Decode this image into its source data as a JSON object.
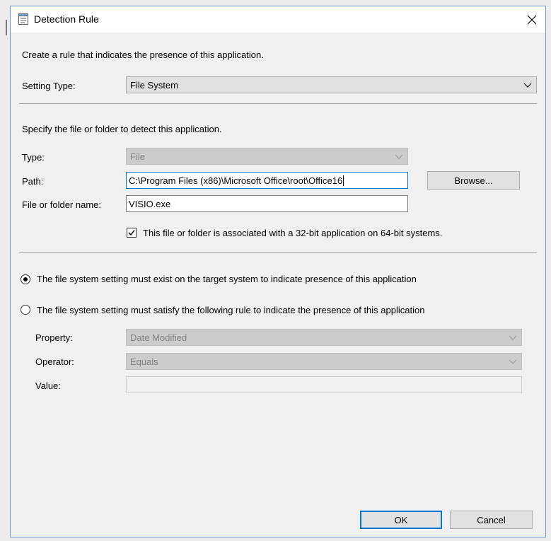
{
  "window": {
    "title": "Detection Rule"
  },
  "intro": "Create a rule that indicates the presence of this application.",
  "setting_type": {
    "label": "Setting Type:",
    "value": "File System"
  },
  "file_section": {
    "heading": "Specify the file or folder to detect this application.",
    "type_label": "Type:",
    "type_value": "File",
    "path_label": "Path:",
    "path_value": "C:\\Program Files (x86)\\Microsoft Office\\root\\Office16",
    "browse_label": "Browse...",
    "name_label": "File or folder name:",
    "name_value": "VISIO.exe",
    "checkbox_label": "This file or folder is associated with a 32-bit application on 64-bit systems.",
    "checkbox_checked": true
  },
  "options": {
    "exist_label": "The file system setting must exist on the target system to indicate presence of this application",
    "rule_label": "The file system setting must satisfy the following rule to indicate the presence of this application",
    "selected": "exist"
  },
  "rule": {
    "property_label": "Property:",
    "property_value": "Date Modified",
    "operator_label": "Operator:",
    "operator_value": "Equals",
    "value_label": "Value:",
    "value_value": ""
  },
  "buttons": {
    "ok": "OK",
    "cancel": "Cancel"
  },
  "colors": {
    "accent": "#0078d7",
    "dialog_bg": "#f0f0f0",
    "border": "#6c9ad6"
  }
}
